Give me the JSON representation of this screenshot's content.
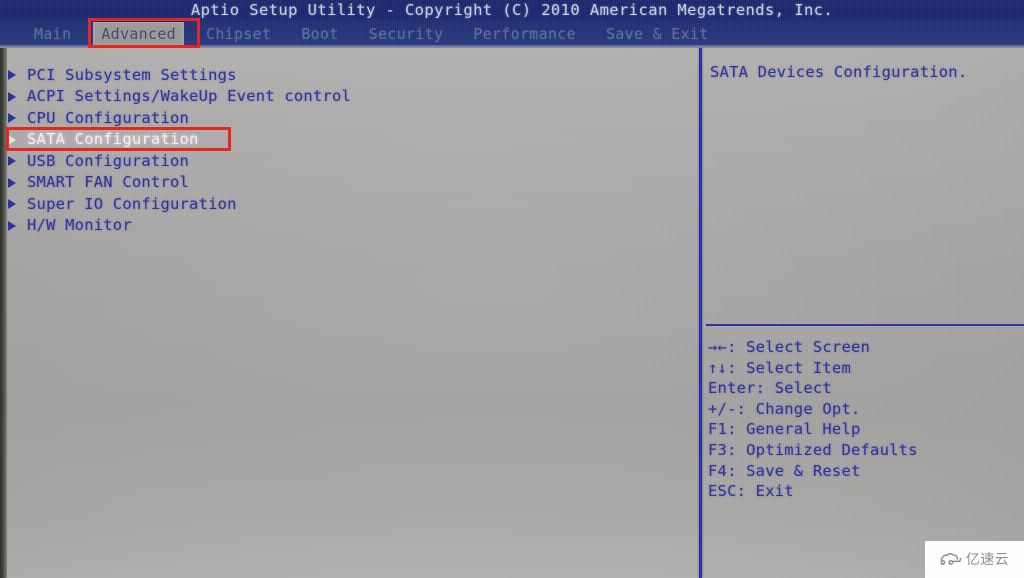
{
  "window": {
    "title": "Aptio Setup Utility - Copyright (C) 2010 American Megatrends, Inc."
  },
  "menu_bar": {
    "tabs": [
      {
        "label": "Main",
        "active": false
      },
      {
        "label": "Advanced",
        "active": true
      },
      {
        "label": "Chipset",
        "active": false
      },
      {
        "label": "Boot",
        "active": false
      },
      {
        "label": "Security",
        "active": false
      },
      {
        "label": "Performance",
        "active": false
      },
      {
        "label": "Save & Exit",
        "active": false
      }
    ]
  },
  "main": {
    "items": [
      {
        "label": "PCI Subsystem Settings",
        "selected": false
      },
      {
        "label": "ACPI Settings/WakeUp Event control",
        "selected": false
      },
      {
        "label": "CPU Configuration",
        "selected": false
      },
      {
        "label": "SATA Configuration",
        "selected": true
      },
      {
        "label": "USB Configuration",
        "selected": false
      },
      {
        "label": "SMART FAN Control",
        "selected": false
      },
      {
        "label": "Super IO Configuration",
        "selected": false
      },
      {
        "label": "H/W Monitor",
        "selected": false
      }
    ]
  },
  "help_panel": {
    "description": "SATA Devices Configuration.",
    "key_legend": [
      "→←: Select Screen",
      "↑↓: Select Item",
      "Enter: Select",
      "+/-: Change Opt.",
      "F1: General Help",
      "F3: Optimized Defaults",
      "F4: Save & Reset",
      "ESC: Exit"
    ]
  },
  "annotations": [
    {
      "target": "Advanced",
      "color": "#e8231c"
    },
    {
      "target": "SATA Configuration",
      "color": "#e8231c"
    }
  ],
  "watermark": {
    "text": "亿速云"
  },
  "colors": {
    "title_bar": "#1a2770",
    "menu_bar": "#24357d",
    "body_background": "#a6a5a3",
    "text_blue": "#2f309b",
    "selected_text": "#f2f1ee",
    "divider": "#2730a6",
    "annotation_red": "#e8231c"
  }
}
